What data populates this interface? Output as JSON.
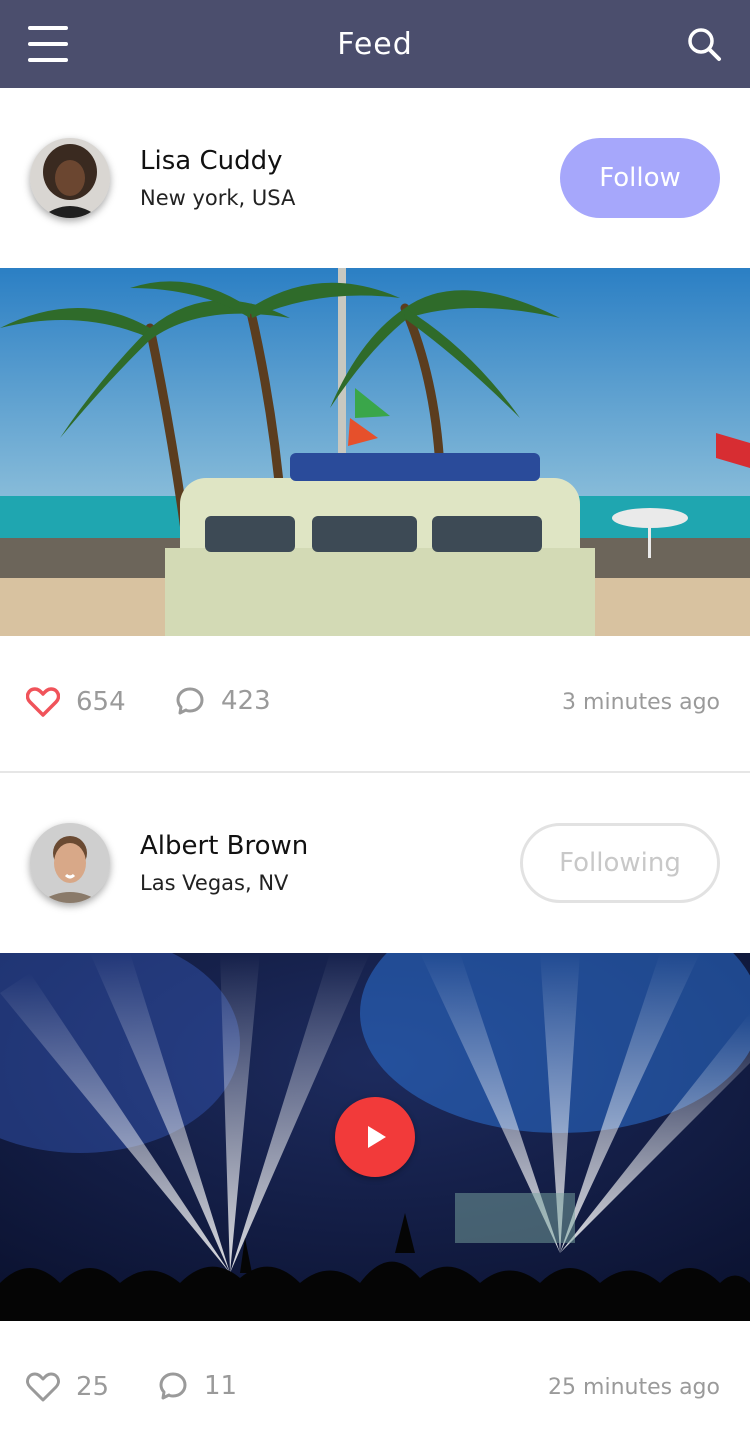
{
  "appbar": {
    "title": "Feed"
  },
  "posts": [
    {
      "user": {
        "name": "Lisa Cuddy",
        "location": "New york, USA"
      },
      "follow_label": "Follow",
      "likes": "654",
      "comments": "423",
      "time": "3 minutes ago",
      "liked": true
    },
    {
      "user": {
        "name": "Albert Brown",
        "location": "Las Vegas, NV"
      },
      "follow_label": "Following",
      "likes": "25",
      "comments": "11",
      "time": "25 minutes ago",
      "liked": false
    }
  ],
  "colors": {
    "appbar": "#4b4e6d",
    "follow_button": "#a6a7fb",
    "like_active": "#f0535a",
    "play_button": "#f23a3a",
    "muted_text": "#9a9a9a"
  },
  "icons": [
    "menu-icon",
    "search-icon",
    "heart-icon",
    "comment-icon",
    "play-icon"
  ]
}
